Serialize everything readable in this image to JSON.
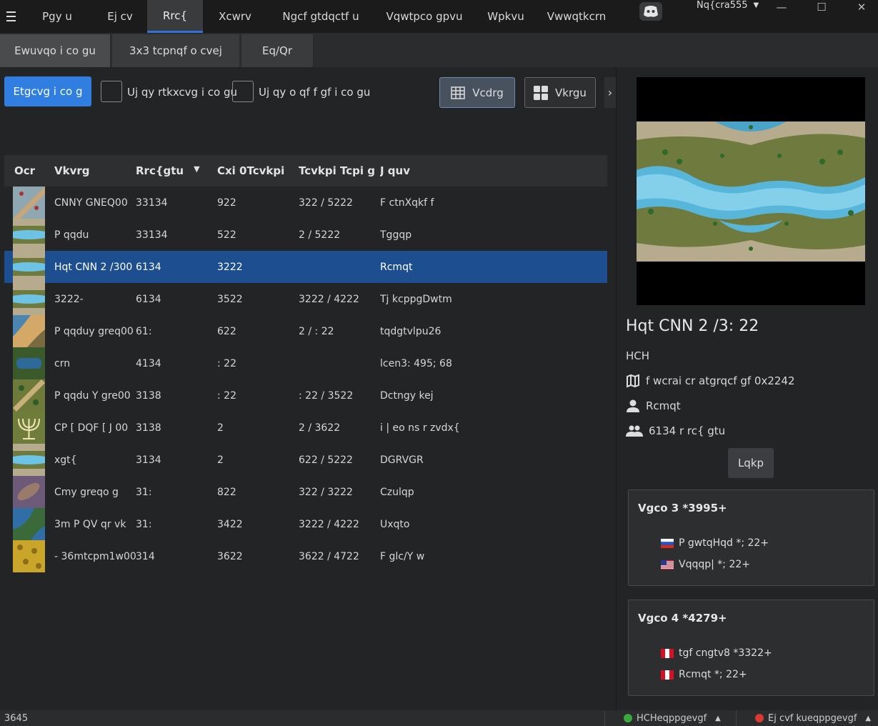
{
  "topbar": {
    "tabs": [
      "Pgy u",
      "Ej cv",
      "Rrc{",
      "Xcwrv",
      "Ngcf gtdqctf u",
      "Vqwtpco gpvu",
      "Wpkvu",
      "Vwwqtkcrn"
    ],
    "active_tab": "Rrc{",
    "username": "Nq{cra555"
  },
  "subtabs": {
    "items": [
      "Ewuvqo i co gu",
      "3x3 tcpnqf o cvej",
      "Eq/Qr"
    ],
    "active": "Ewuvqo i co gu"
  },
  "toolbar": {
    "create_label": "Etgcvg i co g",
    "show_private_label": "Uj qy rtkxcvg i co gu",
    "show_modded_label": "Uj qy o qf f gf i co gu",
    "view_table_label": "Vcdrg",
    "view_tiles_label": "Vkrgu"
  },
  "table": {
    "headers": {
      "map": "Ocr",
      "title": "Vkvrg",
      "players": "Rrc{gtu",
      "size": "Cxi 0Tcvkpi",
      "rank": "Tcvkpi Tcpi g",
      "host": "J quv"
    },
    "rows": [
      {
        "title": "CNNY GNEQ00",
        "players": "33134",
        "size": "922",
        "rank": "322 / 5222",
        "host": "F ctnXqkf f",
        "thumb": "desert",
        "selected": false
      },
      {
        "title": "P qqdu",
        "players": "33134",
        "size": "522",
        "rank": "2 / 5222",
        "host": "Tggqp",
        "thumb": "river",
        "selected": false
      },
      {
        "title": "Hqt CNN 2 /300",
        "players": "6134",
        "size": "3222",
        "rank": "",
        "host": "Rcmqt",
        "thumb": "river",
        "selected": true
      },
      {
        "title": "3222-",
        "players": "6134",
        "size": "3522",
        "rank": "3222 / 4222",
        "host": "Tj kcppgDwtm",
        "thumb": "river",
        "selected": false
      },
      {
        "title": "P qqduy greq00",
        "players": "61:",
        "size": "622",
        "rank": "2 / : 22",
        "host": "tqdgtvlpu26",
        "thumb": "beach",
        "selected": false
      },
      {
        "title": "crn",
        "players": "4134",
        "size": ": 22",
        "rank": "",
        "host": "lcen3: 495; 68",
        "thumb": "lake",
        "selected": false
      },
      {
        "title": "P qqdu Y gre00",
        "players": "3138",
        "size": ": 22",
        "rank": ": 22 / 3522",
        "host": "Dctngy kej",
        "thumb": "forest",
        "selected": false
      },
      {
        "title": "CP [ DQF [ J 00",
        "players": "3138",
        "size": "2",
        "rank": "2 / 3622",
        "host": "i | eo ns r zvdx{",
        "thumb": "menorah",
        "selected": false
      },
      {
        "title": "xgt{",
        "players": "3134",
        "size": "2",
        "rank": "622 / 5222",
        "host": "DGRVGR",
        "thumb": "river",
        "selected": false
      },
      {
        "title": "Cmy greqo g",
        "players": "31:",
        "size": "822",
        "rank": "322 / 3222",
        "host": "Czulqp",
        "thumb": "purple",
        "selected": false
      },
      {
        "title": "3m P QV qr vk",
        "players": "31:",
        "size": "3422",
        "rank": "3222 / 4222",
        "host": "Uxqto",
        "thumb": "ocean",
        "selected": false
      },
      {
        "title": "- 36mtcpm1w00",
        "players": "314",
        "size": "3622",
        "rank": "3622 / 4722",
        "host": "F glc/Y w",
        "thumb": "yellow",
        "selected": false
      }
    ]
  },
  "details": {
    "map_name": "Hqt CNN 2 /3: 22",
    "game_type": "HCH",
    "map_file": "f wcrai cr atgrqcf gf 0x2242",
    "host": "Rcmqt",
    "players": "6134 r rc{ gtu",
    "join_label": "Lqkp",
    "teams": [
      {
        "title": "Vgco 3 *3995+",
        "players": [
          {
            "name": "P gwtqHqd *; 22+",
            "flag": "ru"
          },
          {
            "name": "Vqqqp| *; 22+",
            "flag": "us"
          }
        ]
      },
      {
        "title": "Vgco 4 *4279+",
        "players": [
          {
            "name": "tgf cngtv8 *3322+",
            "flag": "pe"
          },
          {
            "name": "Rcmqt *; 22+",
            "flag": "pe"
          }
        ]
      }
    ]
  },
  "statusbar": {
    "version": "3645",
    "faf_status": "HCHeqppgevgf",
    "chat_status": "Ej cvf kueqppgevgf"
  },
  "colors": {
    "accent": "#2f7ee0",
    "selected_row": "#1d4e8f",
    "status_ok": "#3aa83a",
    "status_err": "#d9392f"
  }
}
